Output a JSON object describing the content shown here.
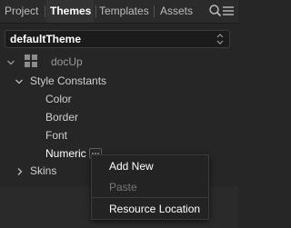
{
  "tabs": [
    {
      "label": "Project",
      "active": false
    },
    {
      "label": "Themes",
      "active": true
    },
    {
      "label": "Templates",
      "active": false
    },
    {
      "label": "Assets",
      "active": false
    }
  ],
  "toolbar_icons": [
    "search-icon",
    "menu-icon"
  ],
  "theme_select": {
    "value": "defaultTheme"
  },
  "tree": {
    "root": {
      "label": "docUp"
    },
    "style_constants": {
      "label": "Style Constants",
      "children": [
        "Color",
        "Border",
        "Font",
        "Numeric"
      ]
    },
    "skins": {
      "label": "Skins"
    }
  },
  "context_menu": {
    "items": [
      {
        "label": "Add New",
        "enabled": true
      },
      {
        "label": "Paste",
        "enabled": false
      },
      {
        "label": "Resource Location",
        "enabled": true
      }
    ]
  },
  "colors": {
    "background": "#262626",
    "text": "#cfcfcf",
    "active_text": "#ffffff",
    "disabled_text": "#777777"
  }
}
